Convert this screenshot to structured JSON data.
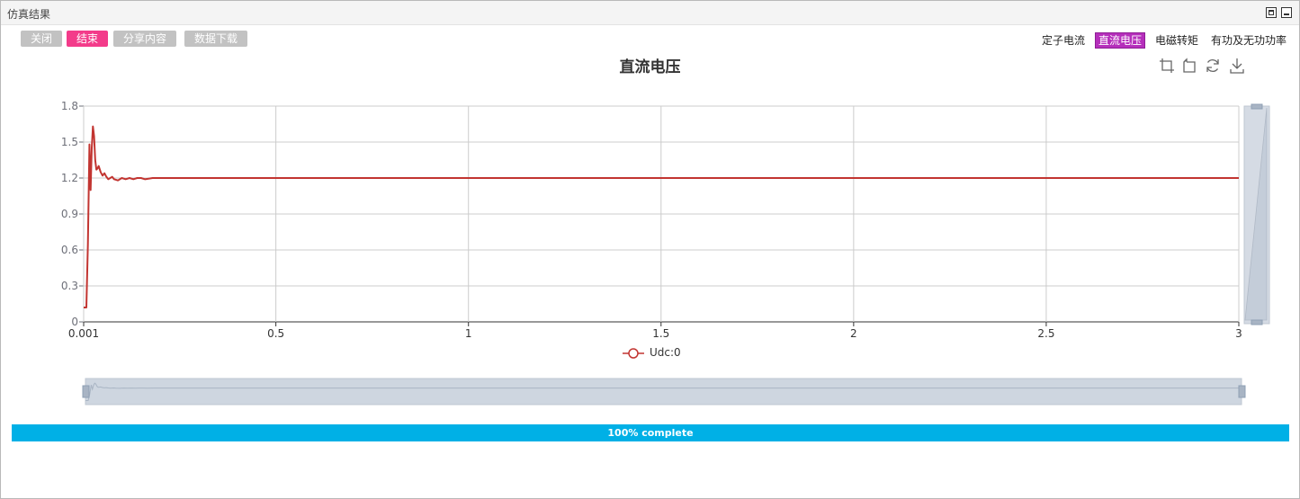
{
  "window": {
    "title": "仿真结果"
  },
  "toolbar": {
    "close_label": "关闭",
    "end_label": "结束",
    "share_label": "分享内容",
    "download_label": "数据下载"
  },
  "tabs": [
    {
      "label": "定子电流",
      "active": false
    },
    {
      "label": "直流电压",
      "active": true
    },
    {
      "label": "电磁转矩",
      "active": false
    },
    {
      "label": "有功及无功功率",
      "active": false
    }
  ],
  "tools": [
    "zoom-select-icon",
    "zoom-reset-icon",
    "restore-icon",
    "save-image-icon"
  ],
  "colors": {
    "series": "#c23531",
    "active_tab": "#b52fbb",
    "end_button": "#f33b8a",
    "progress": "#00b0e6"
  },
  "progress": {
    "text": "100% complete",
    "value": 100
  },
  "chart_data": {
    "type": "line",
    "title": "直流电压",
    "xlim": [
      0.001,
      3
    ],
    "ylim": [
      0,
      1.8
    ],
    "x_ticks": [
      "0.001",
      "0.5",
      "1",
      "1.5",
      "2",
      "2.5",
      "3"
    ],
    "y_ticks": [
      "0",
      "0.3",
      "0.6",
      "0.9",
      "1.2",
      "1.5",
      "1.8"
    ],
    "legend": "bottom-center",
    "grid": true,
    "series": [
      {
        "name": "Udc:0",
        "x": [
          0.001,
          0.008,
          0.012,
          0.016,
          0.019,
          0.022,
          0.025,
          0.028,
          0.031,
          0.034,
          0.037,
          0.04,
          0.045,
          0.05,
          0.055,
          0.06,
          0.065,
          0.07,
          0.075,
          0.08,
          0.09,
          0.1,
          0.11,
          0.12,
          0.13,
          0.14,
          0.15,
          0.16,
          0.18,
          0.2,
          0.22,
          0.25,
          0.3,
          0.4,
          0.6,
          1.0,
          1.5,
          2.0,
          2.5,
          3.0
        ],
        "y": [
          0.12,
          0.12,
          0.65,
          1.48,
          1.1,
          1.45,
          1.63,
          1.55,
          1.35,
          1.27,
          1.28,
          1.3,
          1.25,
          1.22,
          1.24,
          1.21,
          1.19,
          1.2,
          1.21,
          1.19,
          1.18,
          1.2,
          1.19,
          1.2,
          1.19,
          1.2,
          1.2,
          1.19,
          1.2,
          1.2,
          1.2,
          1.2,
          1.2,
          1.2,
          1.2,
          1.2,
          1.2,
          1.2,
          1.2,
          1.2
        ]
      }
    ]
  }
}
